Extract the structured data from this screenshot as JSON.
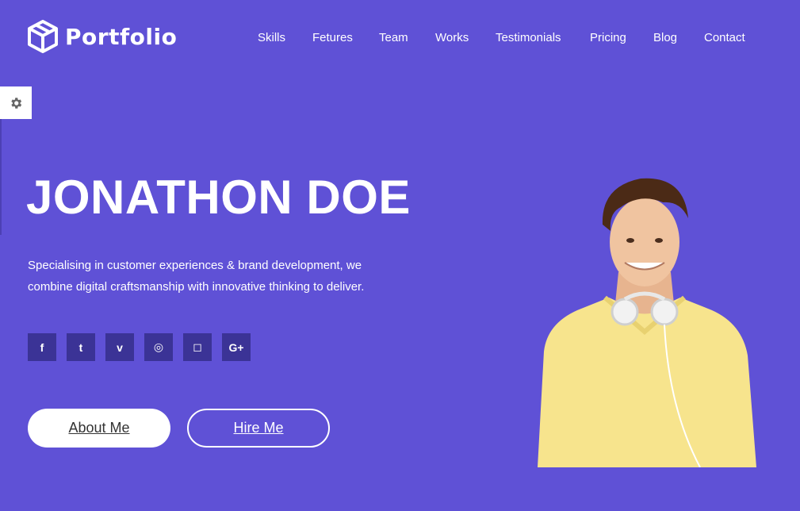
{
  "brand": {
    "name": "Portfolio"
  },
  "nav": {
    "items": [
      "Skills",
      "Fetures",
      "Team",
      "Works",
      "Testimonials",
      "Pricing",
      "Blog",
      "Contact"
    ]
  },
  "hero": {
    "title": "JONATHON DOE",
    "description": "Specialising in customer experiences & brand development, we combine digital craftsmanship with innovative thinking to deliver."
  },
  "social": {
    "icons": [
      {
        "name": "facebook-icon",
        "glyph": "f"
      },
      {
        "name": "twitter-icon",
        "glyph": "t"
      },
      {
        "name": "vimeo-icon",
        "glyph": "v"
      },
      {
        "name": "dribbble-icon",
        "glyph": "◎"
      },
      {
        "name": "instagram-icon",
        "glyph": "◻"
      },
      {
        "name": "google-plus-icon",
        "glyph": "G+"
      }
    ]
  },
  "buttons": {
    "about": "About Me",
    "hire": "Hire Me"
  },
  "colors": {
    "background": "#5f51d6",
    "social_bg": "#3b3396",
    "shirt": "#f7e48d"
  }
}
